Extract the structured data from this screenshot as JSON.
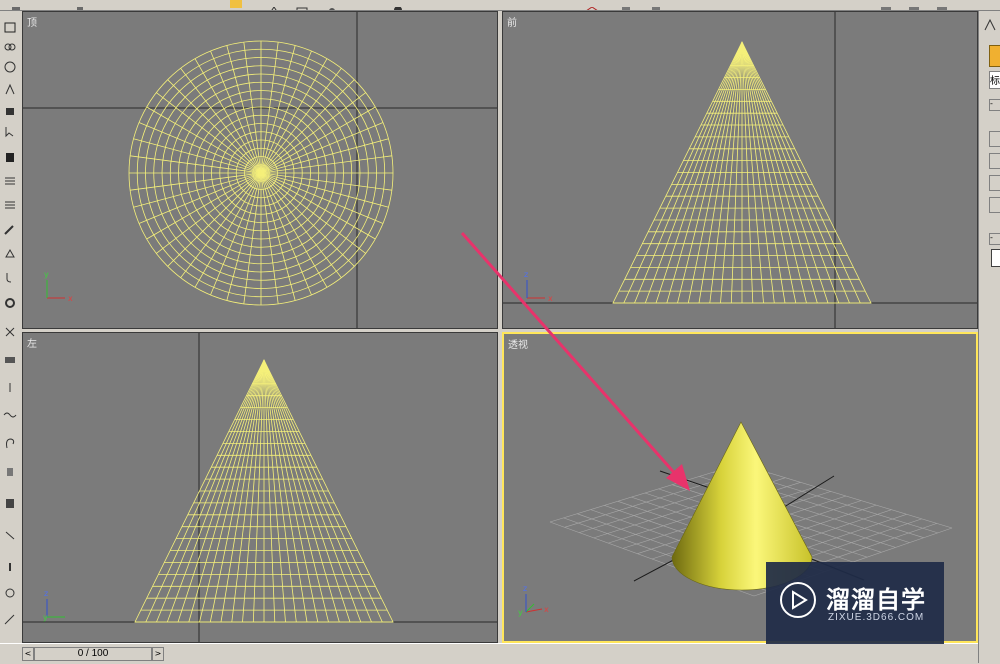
{
  "viewports": {
    "top": {
      "label": "顶"
    },
    "front": {
      "label": "前"
    },
    "left": {
      "label": "左"
    },
    "perspective": {
      "label": "透视"
    }
  },
  "axis": {
    "x": "x",
    "y": "y",
    "z": "z"
  },
  "timeline": {
    "position": "0 / 100"
  },
  "watermark": {
    "title": "溜溜自学",
    "subtitle": "ZIXUE.3D66.COM"
  },
  "right_panel": {
    "tab_label": "标"
  },
  "colors": {
    "wireframe": "#f5f07a",
    "viewport_bg": "#7b7b7b",
    "active_border": "#ffe65a",
    "annotation_arrow": "#e8336b"
  },
  "object": {
    "type": "cone",
    "icon": "cone-icon"
  }
}
